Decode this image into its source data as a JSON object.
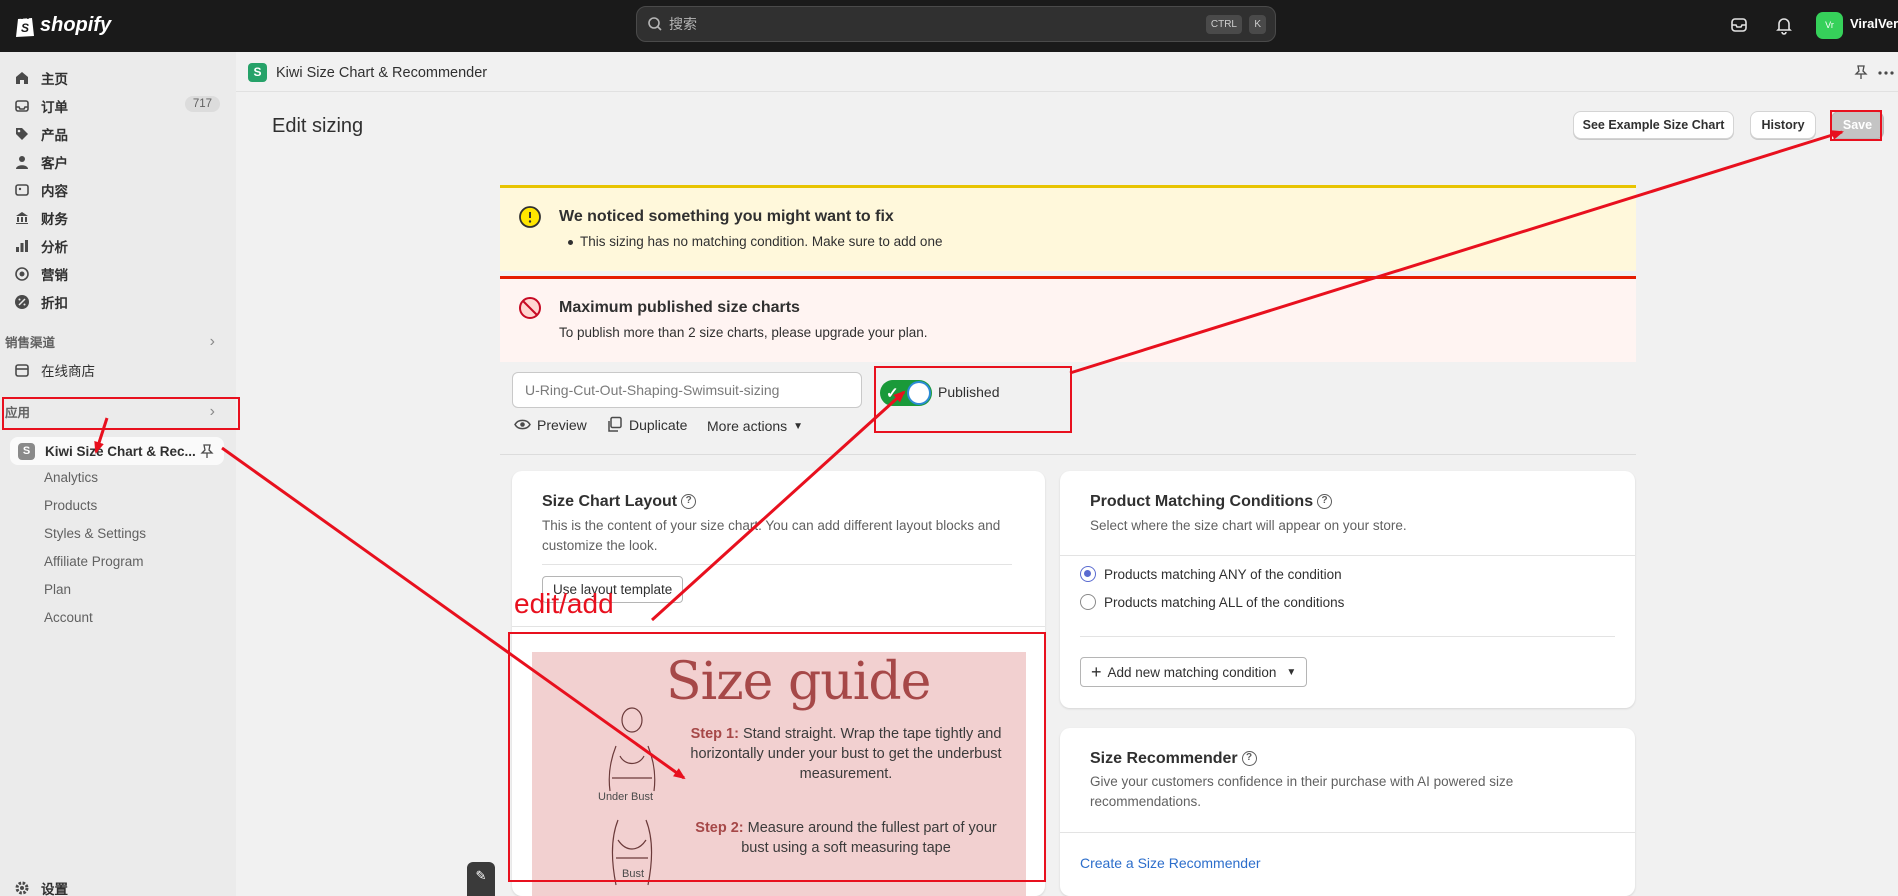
{
  "topbar": {
    "logo_text": "shopify",
    "search_placeholder": "搜索",
    "shortcut_ctrl": "CTRL",
    "shortcut_k": "K",
    "avatar_initials": "Vr",
    "store_name": "ViralVera"
  },
  "sidebar": {
    "nav": [
      {
        "label": "主页",
        "icon": "home-icon"
      },
      {
        "label": "订单",
        "icon": "inbox-icon",
        "badge": "717"
      },
      {
        "label": "产品",
        "icon": "tag-icon"
      },
      {
        "label": "客户",
        "icon": "person-icon"
      },
      {
        "label": "内容",
        "icon": "image-icon"
      },
      {
        "label": "财务",
        "icon": "bank-icon"
      },
      {
        "label": "分析",
        "icon": "bar-chart-icon"
      },
      {
        "label": "营销",
        "icon": "target-icon"
      },
      {
        "label": "折扣",
        "icon": "discount-icon"
      }
    ],
    "sales_channels_label": "销售渠道",
    "online_store_label": "在线商店",
    "apps_label": "应用",
    "active_app": "Kiwi Size Chart & Rec...",
    "app_sub_items": [
      "Analytics",
      "Products",
      "Styles & Settings",
      "Affiliate Program",
      "Plan",
      "Account"
    ],
    "settings_label": "设置"
  },
  "page": {
    "app_title": "Kiwi Size Chart & Recommender",
    "heading": "Edit sizing",
    "buttons": {
      "example": "See Example Size Chart",
      "history": "History",
      "save": "Save"
    }
  },
  "banners": {
    "warning": {
      "title": "We noticed something you might want to fix",
      "item": "This sizing has no matching condition. Make sure to add one"
    },
    "critical": {
      "title": "Maximum published size charts",
      "text": "To publish more than 2 size charts, please upgrade your plan."
    }
  },
  "editor": {
    "name_value": "U-Ring-Cut-Out-Shaping-Swimsuit-sizing",
    "published_label": "Published",
    "published": true,
    "actions": {
      "preview": "Preview",
      "duplicate": "Duplicate",
      "more": "More actions"
    }
  },
  "layout_card": {
    "title": "Size Chart Layout",
    "desc": "This is the content of your size chart. You can add different layout blocks and customize the look.",
    "template_button": "Use layout template"
  },
  "size_guide": {
    "title": "Size guide",
    "step1_label": "Step 1:",
    "step1_text": "Stand straight. Wrap the tape tightly and horizontally under your bust to get the underbust measurement.",
    "step2_label": "Step 2:",
    "step2_text": "Measure around the fullest part of your bust using a soft measuring tape",
    "cap_under": "Under Bust",
    "cap_bust": "Bust"
  },
  "matching_card": {
    "title": "Product Matching Conditions",
    "desc": "Select where the size chart will appear on your store.",
    "option_any": "Products matching ANY of the condition",
    "option_all": "Products matching ALL of the conditions",
    "selected": "any",
    "add_button": "Add new matching condition"
  },
  "recommender_card": {
    "title": "Size Recommender",
    "desc": "Give your customers confidence in their purchase with AI powered size recommendations.",
    "link": "Create a Size Recommender"
  },
  "annotation": {
    "edit_label": "edit/add",
    "color": "#e8101e"
  }
}
